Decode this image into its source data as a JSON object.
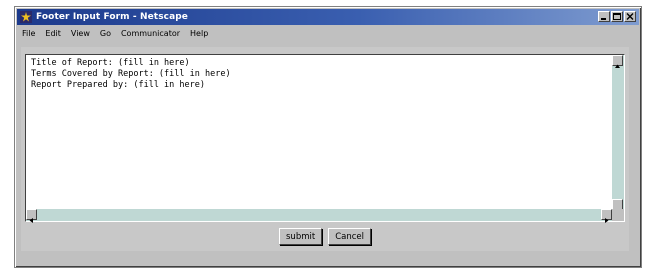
{
  "window": {
    "title": "Footer Input Form - Netscape"
  },
  "menu": {
    "items": [
      "File",
      "Edit",
      "View",
      "Go",
      "Communicator",
      "Help"
    ]
  },
  "form": {
    "textarea": {
      "lines": [
        "Title of Report: (fill in here)",
        "Terms Covered by Report: (fill in here)",
        "Report Prepared by: (fill in here)"
      ]
    },
    "submit_label": "submit",
    "cancel_label": "Cancel"
  },
  "colors": {
    "titlebar_start": "#1c3a8c",
    "titlebar_end": "#7f9cd0",
    "scrollbar_track": "#bfd8d4",
    "chrome_gray": "#c0c0c0"
  },
  "icons": {
    "app": "netscape-icon",
    "minimize": "minimize-icon",
    "maximize": "maximize-icon",
    "close": "close-icon",
    "scroll_up": "arrow-up-icon",
    "scroll_down": "arrow-down-icon",
    "scroll_left": "arrow-left-icon",
    "scroll_right": "arrow-right-icon"
  }
}
